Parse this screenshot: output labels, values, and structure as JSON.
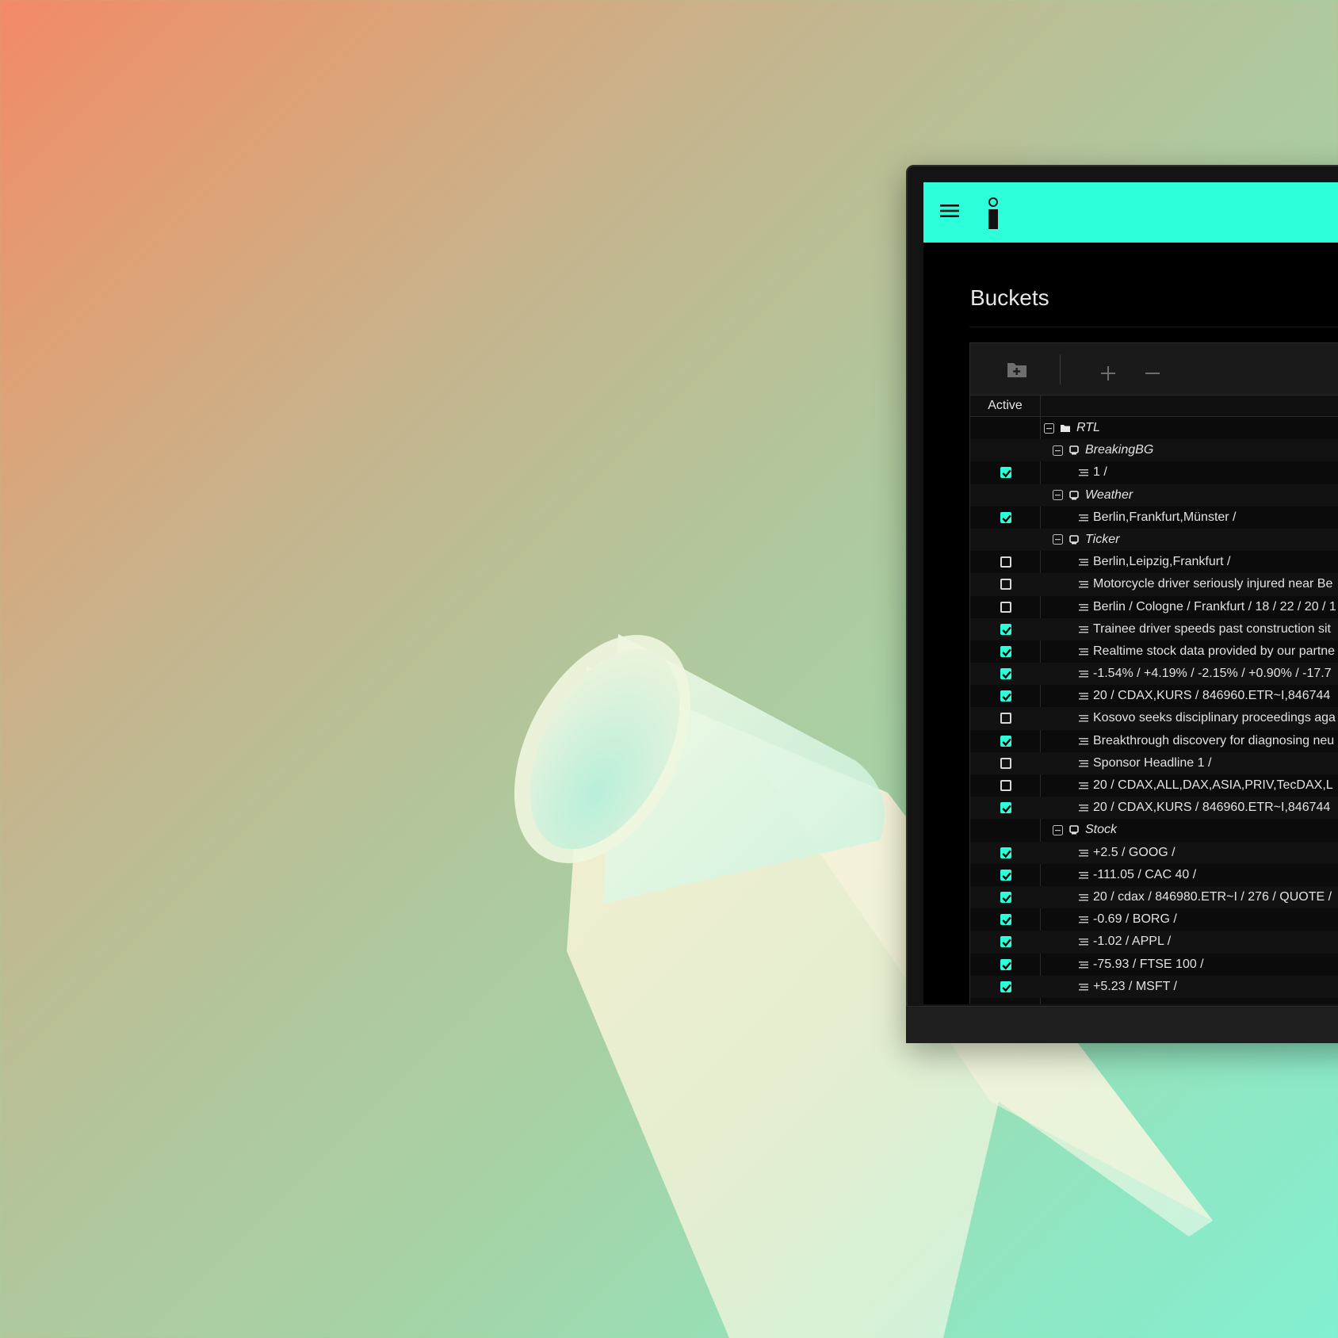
{
  "page": {
    "title": "Buckets"
  },
  "appbar": {
    "menu_icon": "hamburger-menu-icon",
    "logo_icon": "info-logo-icon",
    "color": "#2cffda"
  },
  "toolbar": {
    "add_folder_icon": "folder-plus-icon",
    "add_icon": "plus-icon",
    "remove_icon": "minus-icon"
  },
  "table": {
    "header_active": "Active",
    "rows": [
      {
        "level": 0,
        "type": "folder",
        "label": "RTL",
        "checkbox": null
      },
      {
        "level": 1,
        "type": "bucket",
        "label": "BreakingBG",
        "checkbox": null
      },
      {
        "level": 2,
        "type": "item",
        "label": "1 /",
        "checkbox": true
      },
      {
        "level": 1,
        "type": "bucket",
        "label": "Weather",
        "checkbox": null
      },
      {
        "level": 2,
        "type": "item",
        "label": "Berlin,Frankfurt,Münster /",
        "checkbox": true
      },
      {
        "level": 1,
        "type": "bucket",
        "label": "Ticker",
        "checkbox": null
      },
      {
        "level": 2,
        "type": "item",
        "label": "Berlin,Leipzig,Frankfurt /",
        "checkbox": false
      },
      {
        "level": 2,
        "type": "item",
        "label": "Motorcycle driver seriously injured near Be",
        "checkbox": false
      },
      {
        "level": 2,
        "type": "item",
        "label": "Berlin / Cologne / Frankfurt / 18 / 22 / 20 / 1",
        "checkbox": false
      },
      {
        "level": 2,
        "type": "item",
        "label": "Trainee driver speeds past construction sit",
        "checkbox": true
      },
      {
        "level": 2,
        "type": "item",
        "label": "Realtime stock data provided by our partne",
        "checkbox": true
      },
      {
        "level": 2,
        "type": "item",
        "label": "-1.54% / +4.19% / -2.15% / +0.90% / -17.7",
        "checkbox": true
      },
      {
        "level": 2,
        "type": "item",
        "label": "20 / CDAX,KURS / 846960.ETR~I,846744",
        "checkbox": true
      },
      {
        "level": 2,
        "type": "item",
        "label": "Kosovo seeks disciplinary proceedings aga",
        "checkbox": false
      },
      {
        "level": 2,
        "type": "item",
        "label": "Breakthrough discovery for diagnosing neu",
        "checkbox": true
      },
      {
        "level": 2,
        "type": "item",
        "label": "Sponsor Headline 1 /",
        "checkbox": false
      },
      {
        "level": 2,
        "type": "item",
        "label": "20 / CDAX,ALL,DAX,ASIA,PRIV,TecDAX,L",
        "checkbox": false
      },
      {
        "level": 2,
        "type": "item",
        "label": "20 / CDAX,KURS / 846960.ETR~I,846744",
        "checkbox": true
      },
      {
        "level": 1,
        "type": "bucket",
        "label": "Stock",
        "checkbox": null
      },
      {
        "level": 2,
        "type": "item",
        "label": "+2.5 / GOOG /",
        "checkbox": true
      },
      {
        "level": 2,
        "type": "item",
        "label": "-111.05 / CAC 40 /",
        "checkbox": true
      },
      {
        "level": 2,
        "type": "item",
        "label": "20 / cdax / 846980.ETR~I / 276 / QUOTE /",
        "checkbox": true
      },
      {
        "level": 2,
        "type": "item",
        "label": "-0.69 / BORG /",
        "checkbox": true
      },
      {
        "level": 2,
        "type": "item",
        "label": "-1.02 / APPL /",
        "checkbox": true
      },
      {
        "level": 2,
        "type": "item",
        "label": "-75.93 / FTSE 100 /",
        "checkbox": true
      },
      {
        "level": 2,
        "type": "item",
        "label": "+5.23 / MSFT /",
        "checkbox": true
      }
    ]
  }
}
